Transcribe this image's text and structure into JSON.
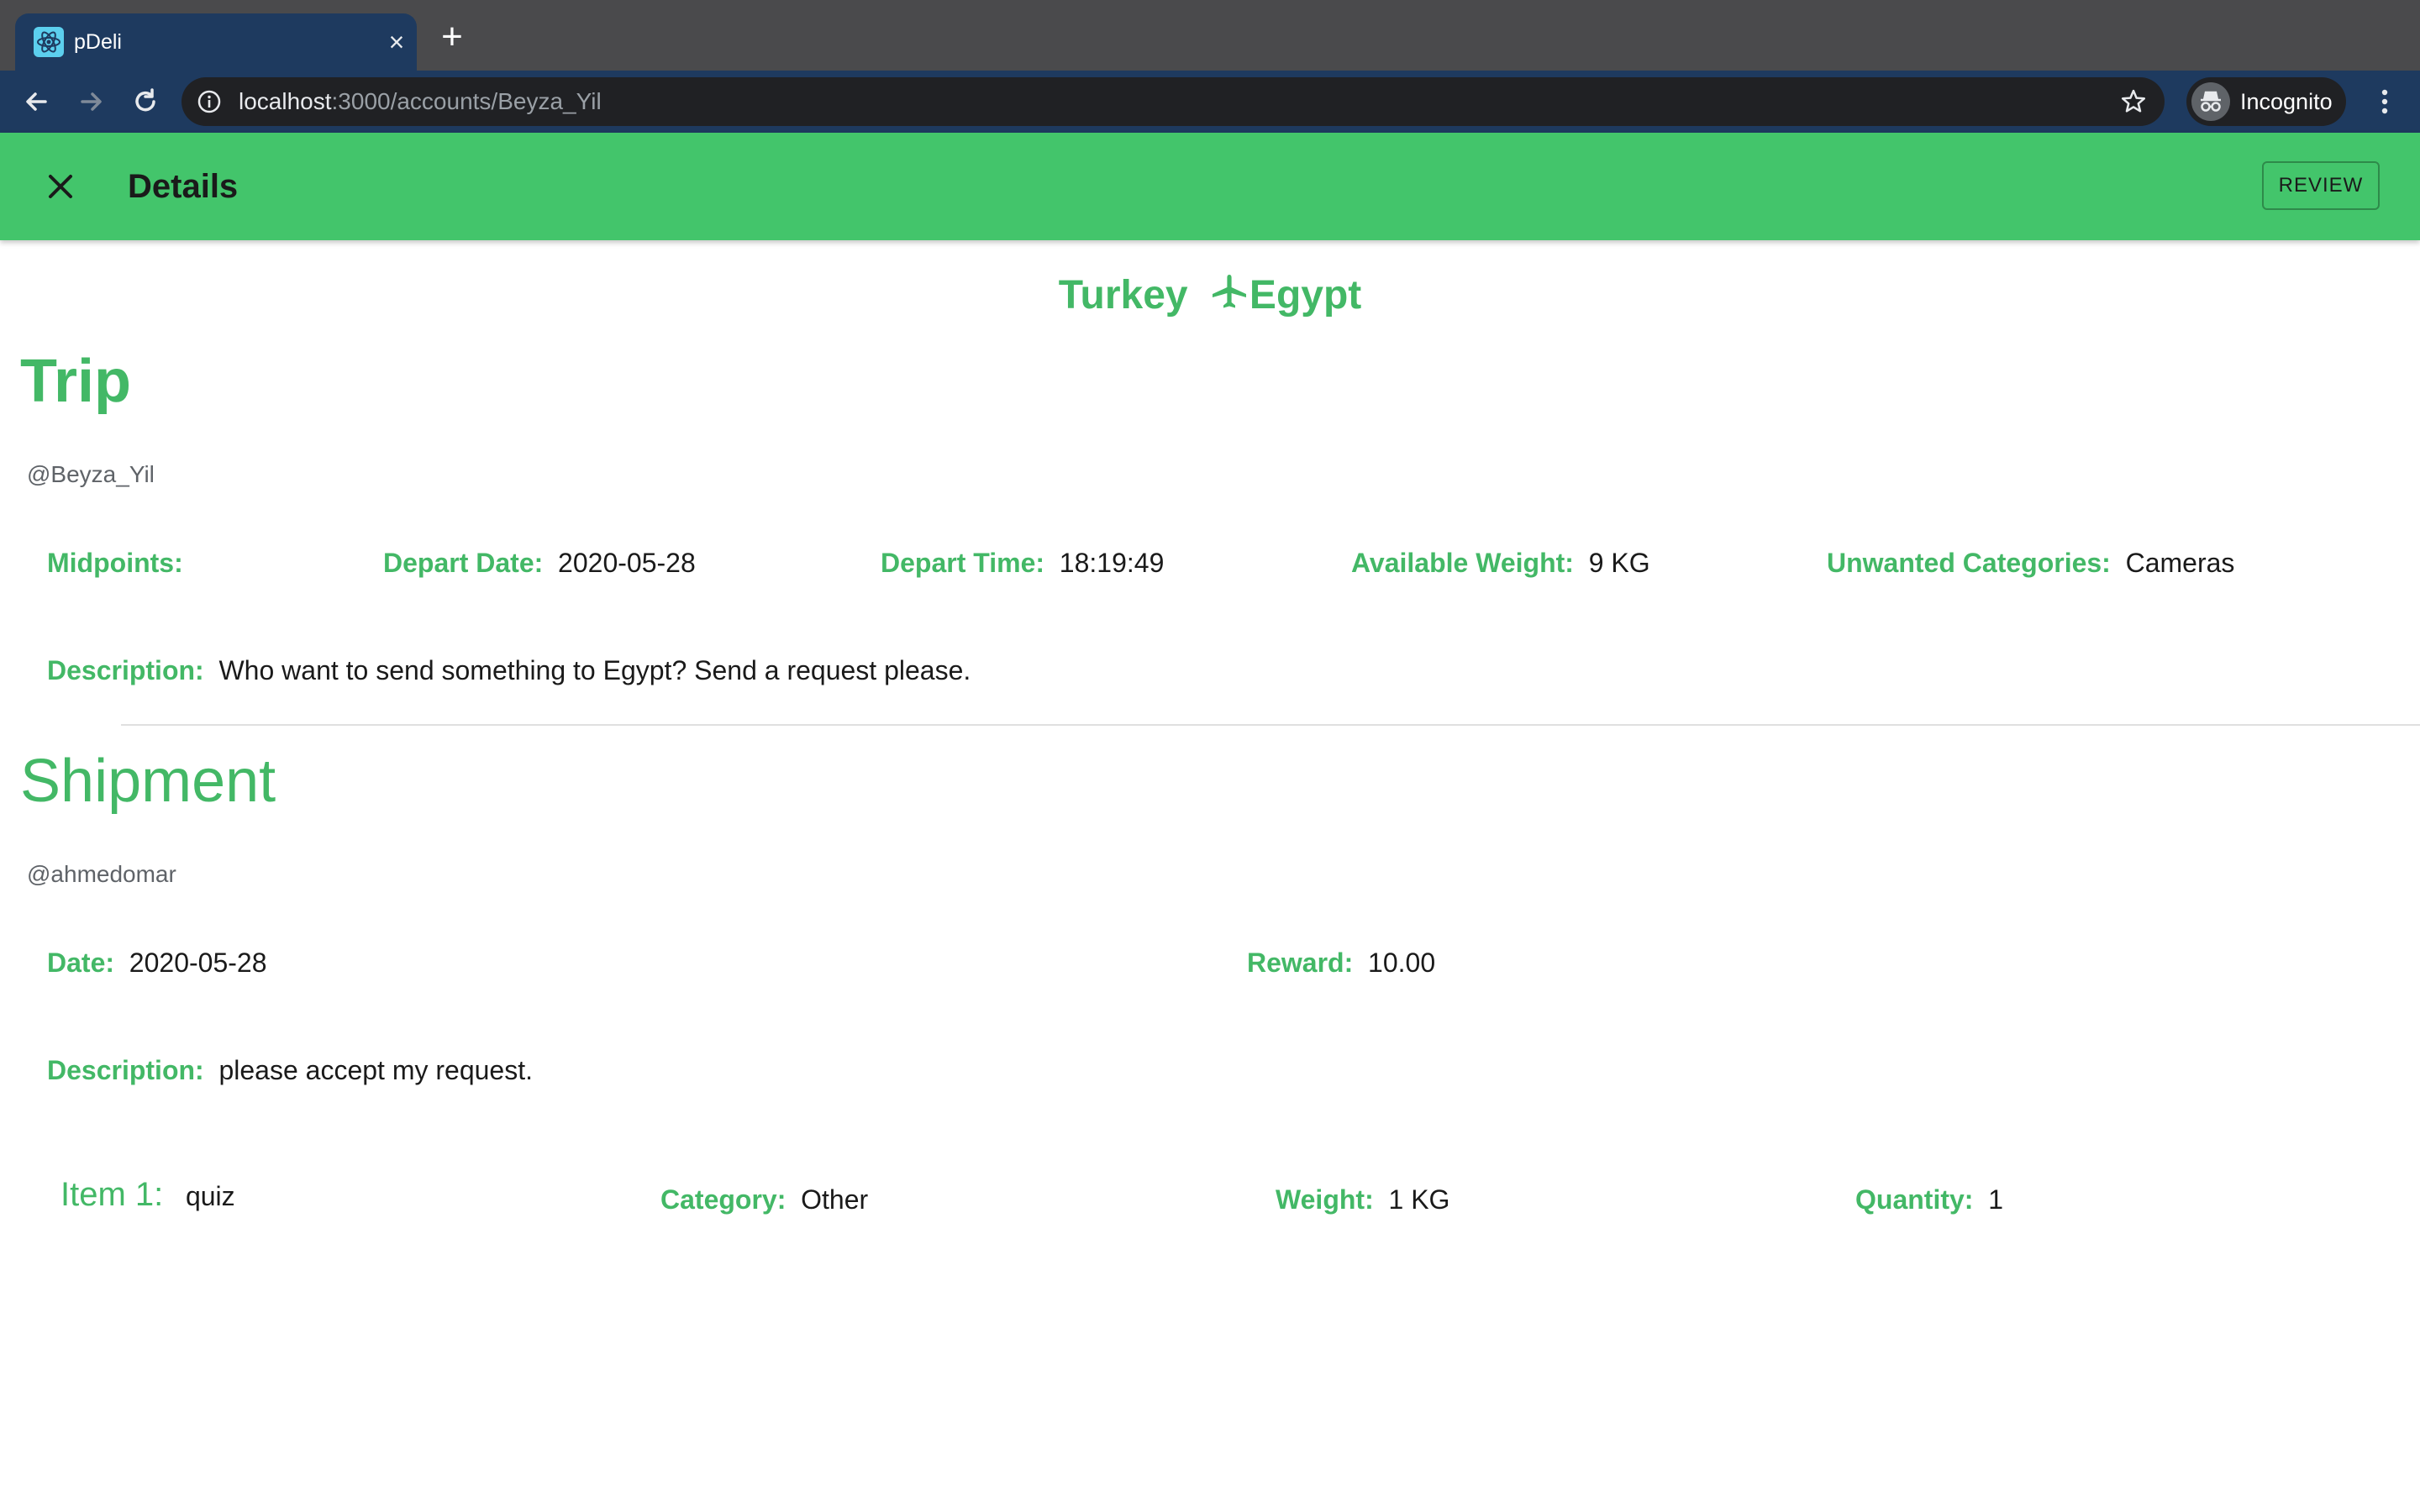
{
  "browser": {
    "tab_title": "pDeli",
    "url_host": "localhost",
    "url_path": ":3000/accounts/Beyza_Yil",
    "profile_label": "Incognito"
  },
  "appbar": {
    "title": "Details",
    "review_label": "REVIEW"
  },
  "route": {
    "origin": "Turkey",
    "destination": "Egypt"
  },
  "trip": {
    "heading": "Trip",
    "username": "@Beyza_Yil",
    "midpoints_label": "Midpoints:",
    "depart_date_label": "Depart Date:",
    "depart_date": "2020-05-28",
    "depart_time_label": "Depart Time:",
    "depart_time": "18:19:49",
    "weight_label": "Available Weight:",
    "weight": "9 KG",
    "unwanted_label": "Unwanted Categories:",
    "unwanted": "Cameras",
    "description_label": "Description:",
    "description": "Who want to send something to Egypt? Send a request please."
  },
  "shipment": {
    "heading": "Shipment",
    "username": "@ahmedomar",
    "date_label": "Date:",
    "date": "2020-05-28",
    "reward_label": "Reward:",
    "reward": "10.00",
    "description_label": "Description:",
    "description": "please accept my request.",
    "items": [
      {
        "label": "Item 1:",
        "name": "quiz",
        "category_label": "Category:",
        "category": "Other",
        "weight_label": "Weight:",
        "weight": "1 KG",
        "quantity_label": "Quantity:",
        "quantity": "1"
      }
    ]
  },
  "colors": {
    "accent_green": "#43c56b",
    "text_green": "#43b866",
    "browser_toolbar": "#1e3a5f"
  }
}
